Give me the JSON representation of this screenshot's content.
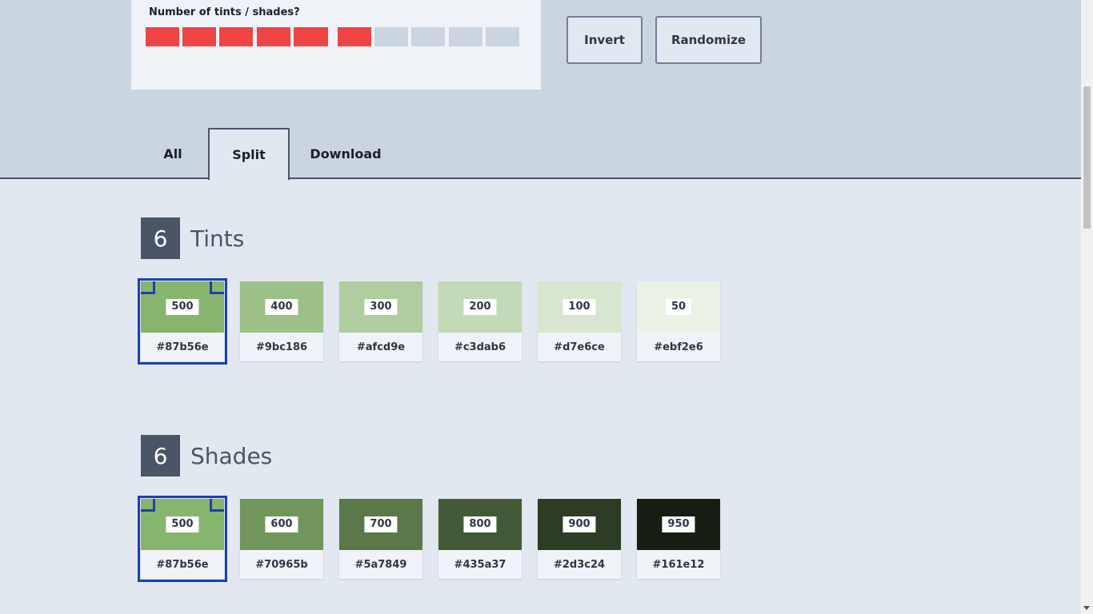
{
  "controls": {
    "count_label": "Number of tints / shades?",
    "count_value": 6,
    "count_max": 10,
    "active_color": "#ef4444",
    "inactive_color": "#cbd5e0",
    "invert_label": "Invert",
    "randomize_label": "Randomize"
  },
  "tabs": {
    "all": "All",
    "split": "Split",
    "download": "Download",
    "active": "Split"
  },
  "tints": {
    "count": "6",
    "title": "Tints",
    "swatches": [
      {
        "weight": "500",
        "hex": "#87b56e",
        "color": "#87b56e",
        "selected": true
      },
      {
        "weight": "400",
        "hex": "#9bc186",
        "color": "#9bc186"
      },
      {
        "weight": "300",
        "hex": "#afcd9e",
        "color": "#afcd9e"
      },
      {
        "weight": "200",
        "hex": "#c3dab6",
        "color": "#c3dab6"
      },
      {
        "weight": "100",
        "hex": "#d7e6ce",
        "color": "#d7e6ce"
      },
      {
        "weight": "50",
        "hex": "#ebf2e6",
        "color": "#ebf2e6"
      }
    ]
  },
  "shades": {
    "count": "6",
    "title": "Shades",
    "swatches": [
      {
        "weight": "500",
        "hex": "#87b56e",
        "color": "#87b56e",
        "selected": true
      },
      {
        "weight": "600",
        "hex": "#70965b",
        "color": "#70965b"
      },
      {
        "weight": "700",
        "hex": "#5a7849",
        "color": "#5a7849"
      },
      {
        "weight": "800",
        "hex": "#435a37",
        "color": "#435a37"
      },
      {
        "weight": "900",
        "hex": "#2d3c24",
        "color": "#2d3c24"
      },
      {
        "weight": "950",
        "hex": "#161e12",
        "color": "#161e12"
      }
    ]
  }
}
